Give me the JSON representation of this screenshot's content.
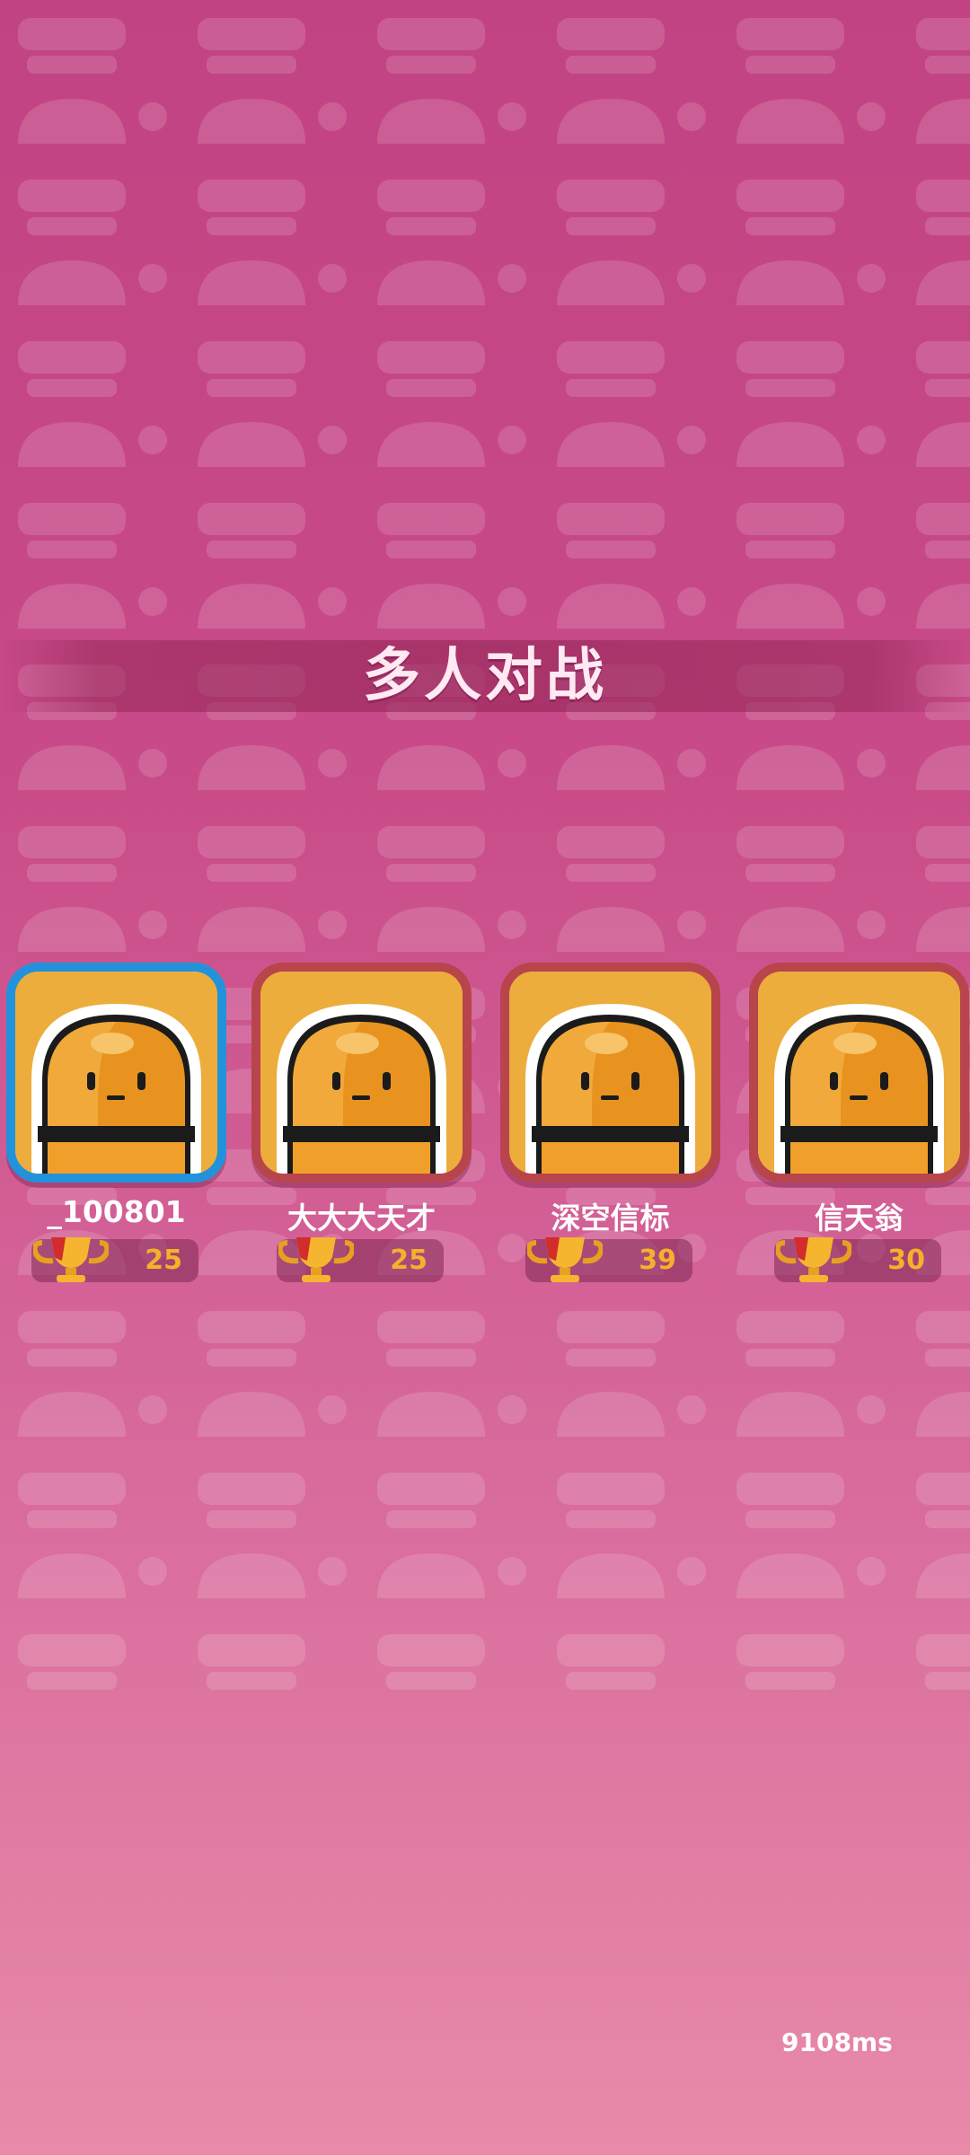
{
  "header": {
    "title": "多人对战"
  },
  "players": [
    {
      "name": "_100801",
      "trophies": "25",
      "is_self": true
    },
    {
      "name": "大大大天才",
      "trophies": "25",
      "is_self": false
    },
    {
      "name": "深空信标",
      "trophies": "39",
      "is_self": false
    },
    {
      "name": "信天翁",
      "trophies": "30",
      "is_self": false
    }
  ],
  "status": {
    "timer": "9108ms"
  },
  "colors": {
    "background_top": "#c24383",
    "background_bottom": "#e98aaa",
    "self_border": "#2292dc",
    "opponent_border": "#b8444c",
    "avatar_fill": "#ecad3c",
    "trophy_text": "#f6b02b"
  },
  "icons": {
    "avatar": "orange-blob-character-icon",
    "trophy": "trophy-icon"
  }
}
